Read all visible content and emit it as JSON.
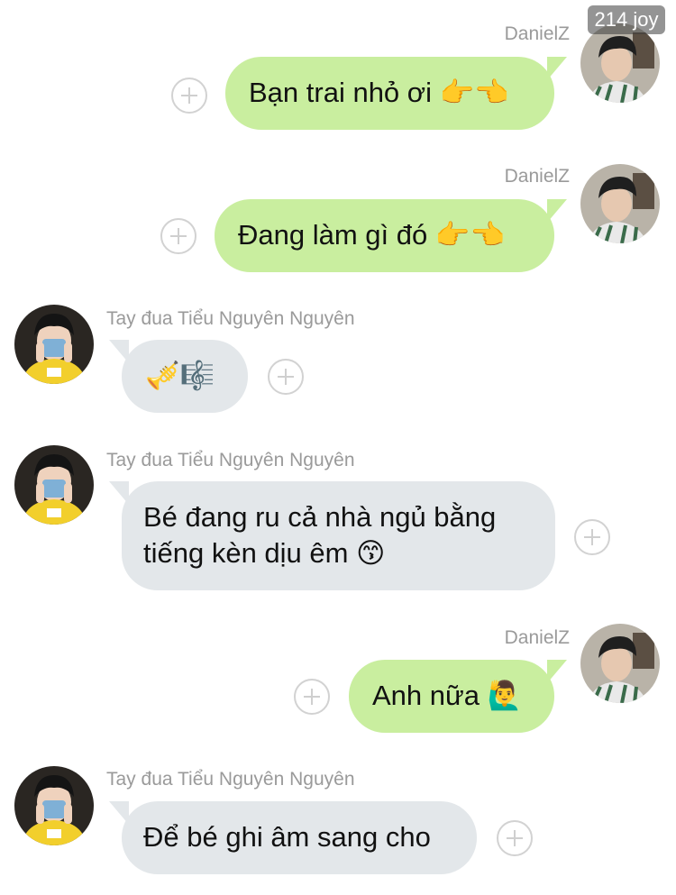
{
  "watermark": "214 joy",
  "messages": [
    {
      "sender": "DanielZ",
      "side": "right",
      "text": "Bạn trai nhỏ ơi 👉👈"
    },
    {
      "sender": "DanielZ",
      "side": "right",
      "text": "Đang làm gì đó 👉👈"
    },
    {
      "sender": "Tay đua Tiểu Nguyên Nguyên",
      "side": "left",
      "text": "🎺🎼"
    },
    {
      "sender": "Tay đua Tiểu Nguyên Nguyên",
      "side": "left",
      "text": "Bé đang ru cả nhà ngủ bằng tiếng kèn dịu êm 😙"
    },
    {
      "sender": "DanielZ",
      "side": "right",
      "text": "Anh nữa 🙋‍♂️"
    },
    {
      "sender": "Tay đua Tiểu Nguyên Nguyên",
      "side": "left",
      "text": "Để bé ghi âm sang cho"
    }
  ],
  "colors": {
    "my_bubble": "#c9ee9f",
    "their_bubble": "#e3e7ea",
    "name_text": "#9a9a9a"
  }
}
